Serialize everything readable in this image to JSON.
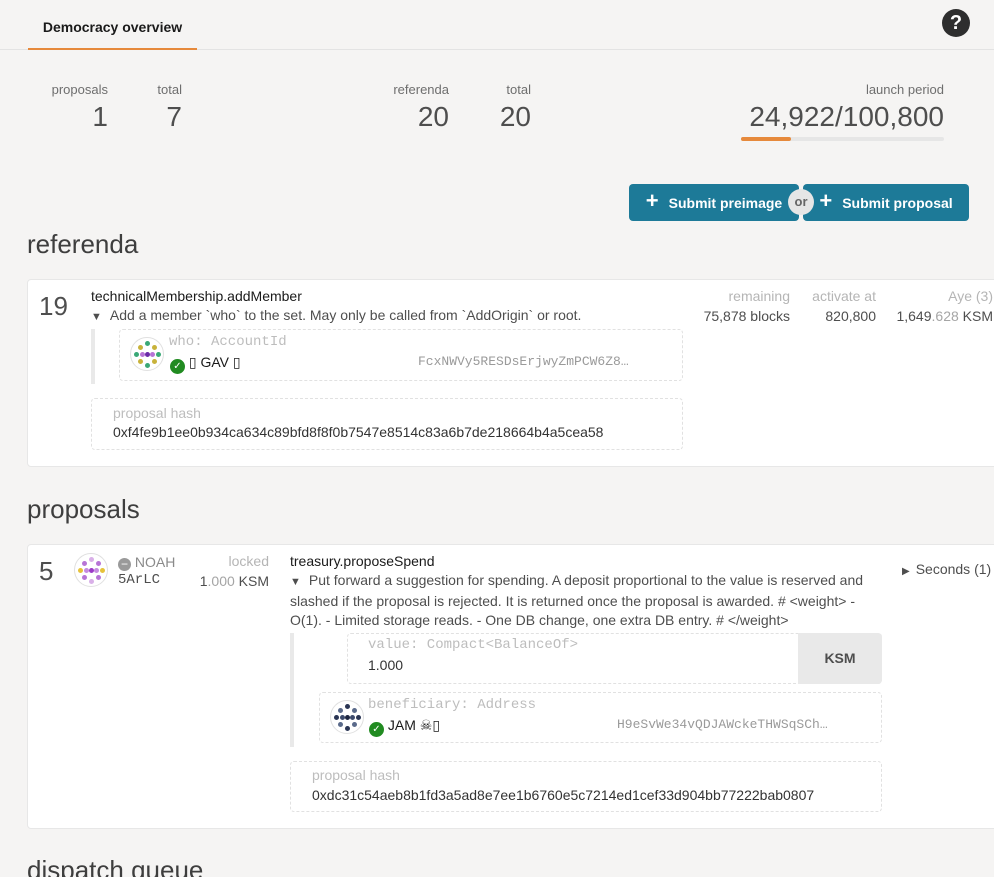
{
  "tabs": {
    "overview": "Democracy overview"
  },
  "summary": {
    "proposals_label": "proposals",
    "proposals_value": "1",
    "proposals_total_label": "total",
    "proposals_total_value": "7",
    "referenda_label": "referenda",
    "referenda_value": "20",
    "referenda_total_label": "total",
    "referenda_total_value": "20",
    "launch_label": "launch period",
    "launch_value": "24,922/100,800",
    "launch_progress_fraction": 0.247
  },
  "actions": {
    "submit_preimage": "Submit preimage",
    "or": "or",
    "submit_proposal": "Submit proposal"
  },
  "sections": {
    "referenda": "referenda",
    "proposals": "proposals",
    "dispatch": "dispatch queue"
  },
  "referendum": {
    "index": "19",
    "call": "technicalMembership.addMember",
    "description": "Add a member `who` to the set. May only be called from `AddOrigin` or root.",
    "param_label": "who: AccountId",
    "account_name": "▯ GAV ▯",
    "account_address": "FcxNWVy5RESDsErjwyZmPCW6Z8…",
    "hash_label": "proposal hash",
    "hash_value": "0xf4fe9b1ee0b934ca634c89bfd8f8f0b7547e8514c83a6b7de218664b4a5cea58",
    "remaining_label": "remaining",
    "remaining_value": "75,878 blocks",
    "activate_label": "activate at",
    "activate_value": "820,800",
    "aye_label": "Aye (3)",
    "aye_int": "1,649",
    "aye_frac": ".628",
    "aye_unit": " KSM"
  },
  "proposal": {
    "index": "5",
    "proposer_name": "NOAH",
    "proposer_short": "5ArLC",
    "locked_label": "locked",
    "locked_int": "1",
    "locked_frac": ".000",
    "locked_unit": " KSM",
    "call": "treasury.proposeSpend",
    "description": "Put forward a suggestion for spending. A deposit proportional to the value is reserved and slashed if the proposal is rejected. It is returned once the proposal is awarded. # <weight> - O(1). - Limited storage reads. - One DB change, one extra DB entry. # </weight>",
    "value_label": "value: Compact<BalanceOf>",
    "value_value": "1.000",
    "value_unit": "KSM",
    "beneficiary_label": "beneficiary: Address",
    "beneficiary_name": "JAM ☠▯",
    "beneficiary_address": "H9eSvWe34vQDJAWckeTHWSqSCh…",
    "hash_label": "proposal hash",
    "hash_value": "0xdc31c54aeb8b1fd3a5ad8e7ee1b6760e5c7214ed1cef33d904bb77222bab0807",
    "seconds": "Seconds (1)"
  },
  "colors": {
    "accent": "#e6893b",
    "button": "#1d7a98",
    "ok": "#218b21"
  }
}
